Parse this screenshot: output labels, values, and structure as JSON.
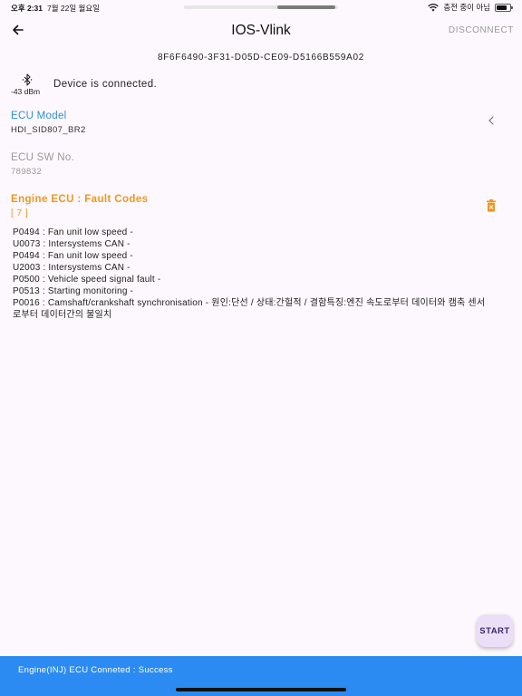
{
  "status_bar": {
    "time": "오후 2:31",
    "date": "7월 22일 월요일",
    "charging_text": "충전 중이 아님",
    "battery_level": 0.75
  },
  "app_bar": {
    "title": "IOS-Vlink",
    "disconnect_label": "DISCONNECT",
    "back_icon": "arrow-left-icon"
  },
  "device": {
    "id": "8F6F6490-3F31-D05D-CE09-D5166B559A02",
    "rssi": "-43 dBm",
    "status_text": "Device is connected.",
    "bluetooth_icon": "bluetooth-icon"
  },
  "ecu_model": {
    "label": "ECU Model",
    "value": "HDI_SID807_BR2"
  },
  "ecu_sw": {
    "label": "ECU SW No.",
    "value": "789832"
  },
  "fault_codes": {
    "title": "Engine ECU : Fault Codes",
    "count": "[ 7 ]",
    "items": [
      "P0494 : Fan unit low speed -",
      "U0073 : Intersystems CAN -",
      "P0494 : Fan unit low speed -",
      "U2003 : Intersystems CAN -",
      "P0500 : Vehicle speed signal fault -",
      "P0513 : Starting monitoring -",
      "P0016 : Camshaft/crankshaft synchronisation - 원인:단선 / 상태:간헐적 / 결함특징:엔진 속도로부터 데이터와 캠축 센서로부터 데이터간의 불일치"
    ]
  },
  "start_button": {
    "label": "START"
  },
  "snackbar": {
    "message": "Engine(INJ) ECU Conneted : Success"
  },
  "colors": {
    "background": "#fdf8fd",
    "ecu_model_label": "#2f8fd8",
    "fault_accent": "#f0961c",
    "snackbar": "#2c8bf2",
    "disabled_text": "#9a9a9a"
  }
}
